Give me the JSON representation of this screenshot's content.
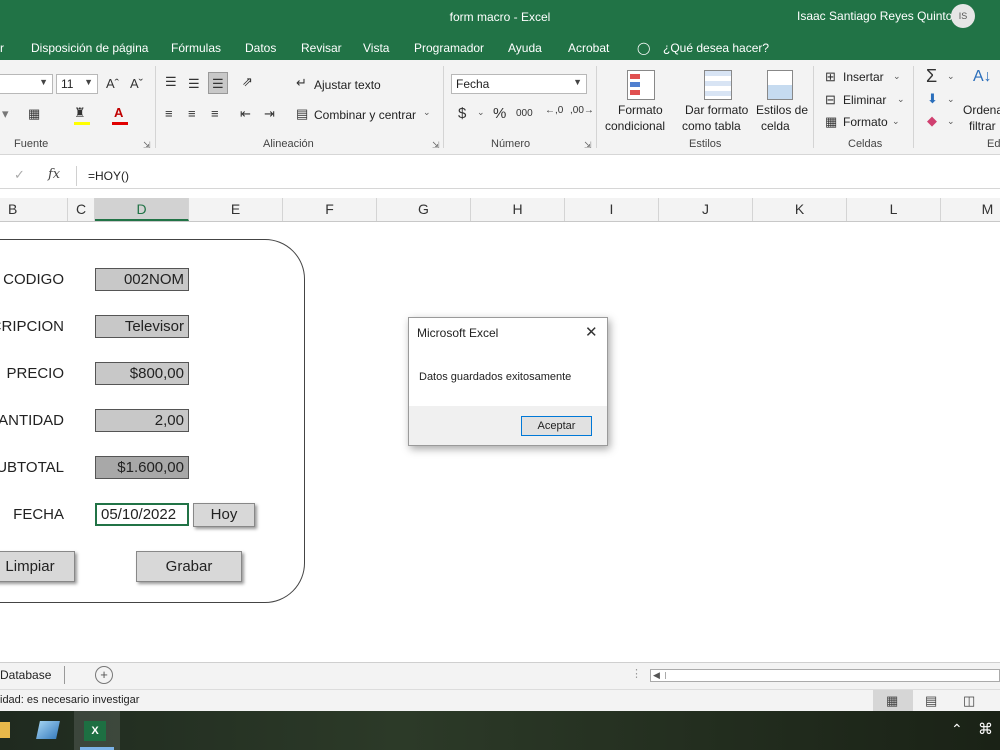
{
  "window": {
    "title": "form macro  -  Excel",
    "user_name": "Isaac Santiago Reyes Quinto",
    "user_initials": "IS"
  },
  "menu": [
    "r",
    "Disposición de página",
    "Fórmulas",
    "Datos",
    "Revisar",
    "Vista",
    "Programador",
    "Ayuda",
    "Acrobat",
    "¿Qué desea hacer?"
  ],
  "ribbon": {
    "font_size": "11",
    "font_group": "Fuente",
    "alignment_group": "Alineación",
    "wrap_text": "Ajustar texto",
    "merge_center": "Combinar y centrar",
    "number_format": "Fecha",
    "number_group": "Número",
    "currency_symbol": "$",
    "percent_symbol": "%",
    "thousands_symbol": "000",
    "styles_group": "Estilos",
    "conditional_format": [
      "Formato",
      "condicional"
    ],
    "format_table": [
      "Dar formato",
      "como tabla"
    ],
    "cell_styles": [
      "Estilos de",
      "celda"
    ],
    "cells_group": "Celdas",
    "insert": "Insertar",
    "delete": "Eliminar",
    "format": "Formato",
    "sort_filter": [
      "Ordena",
      "filtrar"
    ],
    "edit_group": "Ed"
  },
  "formula_bar": {
    "fx": "fx",
    "formula": "=HOY()"
  },
  "columns": [
    {
      "label": "B"
    },
    {
      "label": "C"
    },
    {
      "label": "D",
      "selected": true
    },
    {
      "label": "E"
    },
    {
      "label": "F"
    },
    {
      "label": "G"
    },
    {
      "label": "H"
    },
    {
      "label": "I"
    },
    {
      "label": "J"
    },
    {
      "label": "K"
    },
    {
      "label": "L"
    },
    {
      "label": "M"
    }
  ],
  "form": {
    "codigo_label": "CODIGO",
    "codigo_value": "002NOM",
    "descripcion_label": "CRIPCION",
    "descripcion_value": "Televisor",
    "precio_label": "PRECIO",
    "precio_value": "$800,00",
    "cantidad_label": "ANTIDAD",
    "cantidad_value": "2,00",
    "subtotal_label": "UBTOTAL",
    "subtotal_value": "$1.600,00",
    "fecha_label": "FECHA",
    "fecha_value": "05/10/2022",
    "hoy_button": "Hoy",
    "limpiar_button": "Limpiar",
    "grabar_button": "Grabar"
  },
  "dialog": {
    "title": "Microsoft Excel",
    "message": "Datos guardados exitosamente",
    "ok_button": "Aceptar"
  },
  "sheet_tabs": {
    "active": "Database"
  },
  "status_bar": {
    "accessibility": "idad: es necesario investigar"
  },
  "colors": {
    "excel_green": "#217346",
    "ribbon_bg": "#f3f3f3"
  }
}
